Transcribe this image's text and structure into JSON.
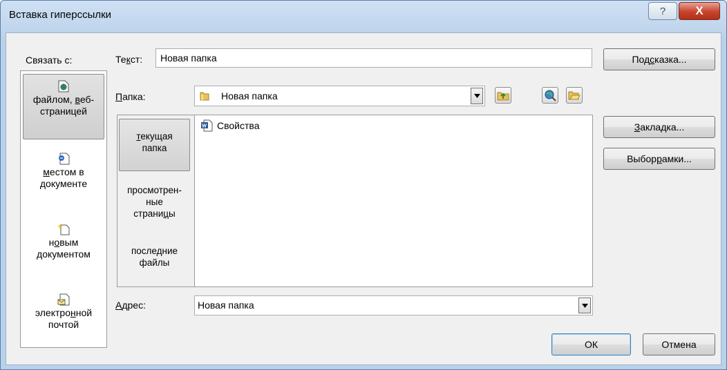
{
  "window": {
    "title": "Вставка гиперссылки",
    "help_glyph": "?",
    "close_glyph": "X"
  },
  "link_with": {
    "label": "Связать с:",
    "places": [
      {
        "label_a": "файлом, ",
        "label_u": "в",
        "label_b": "еб-",
        "label_c": "страницей",
        "icon": "file-web-icon"
      },
      {
        "label_u": "м",
        "label_a": "естом в",
        "label_c": "документе",
        "icon": "place-in-document-icon"
      },
      {
        "label_a": "н",
        "label_u": "о",
        "label_b": "вым",
        "label_c": "документом",
        "icon": "new-document-icon"
      },
      {
        "label_a": "электро",
        "label_u": "н",
        "label_b": "ной",
        "label_c": "почтой",
        "icon": "email-icon"
      }
    ]
  },
  "text_field": {
    "label_a": "Те",
    "label_u": "к",
    "label_b": "ст:",
    "value": "Новая папка"
  },
  "folder": {
    "label_u": "П",
    "label_b": "апка:",
    "value": "Новая папка"
  },
  "subtabs": [
    {
      "label_u": "т",
      "label_a": "екущая",
      "label_c": "папка"
    },
    {
      "label_a": "просмотрен-",
      "label_b": "ные",
      "label_c": "страни",
      "label_u": "ц",
      "label_d": "ы"
    },
    {
      "label_a": "после",
      "label_u": "д",
      "label_b": "ние",
      "label_c": "файлы"
    }
  ],
  "files": [
    {
      "name": "Свойства",
      "icon": "word-document-icon"
    }
  ],
  "address": {
    "label_u": "А",
    "label_b": "дрес:",
    "value": "Новая папка"
  },
  "buttons": {
    "tip_a": "Под",
    "tip_u": "с",
    "tip_b": "казка...",
    "bookmark_u": "З",
    "bookmark_b": "акладка...",
    "frame_a": "Выбор ",
    "frame_u": "р",
    "frame_b": "амки...",
    "ok": "ОК",
    "cancel": "Отмена"
  }
}
